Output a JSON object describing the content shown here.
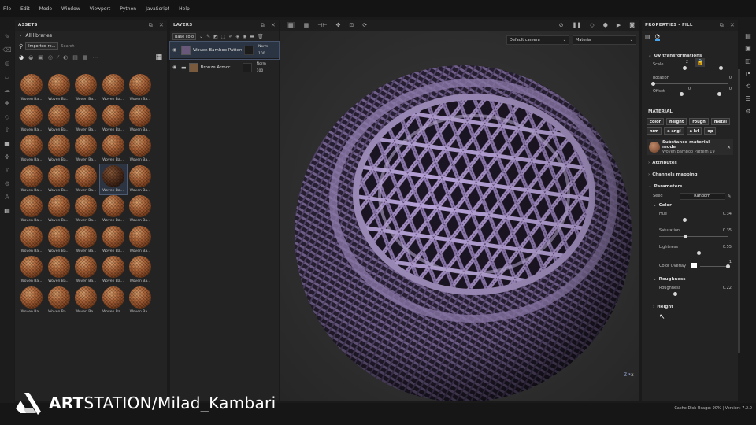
{
  "menu": [
    "File",
    "Edit",
    "Mode",
    "Window",
    "Viewport",
    "Python",
    "JavaScript",
    "Help"
  ],
  "assets": {
    "title": "ASSETS",
    "library": "All libraries",
    "filter_chip": "Imported re...",
    "search_placeholder": "Search",
    "item_label": "Woven Ba...",
    "item_count": 40,
    "selected_index": 18
  },
  "layers": {
    "title": "LAYERS",
    "channel": "Base colo",
    "items": [
      {
        "name": "Woven Bamboo Pattern 19",
        "blend": "Norm",
        "opacity": "100",
        "selected": true
      },
      {
        "name": "Bronze Armor",
        "blend": "Norm",
        "opacity": "100",
        "selected": false
      }
    ]
  },
  "viewport": {
    "camera": "Default camera",
    "mode": "Material"
  },
  "properties": {
    "title": "PROPERTIES - FILL",
    "uv_title": "UV transformations",
    "scale_label": "Scale",
    "scale_value": "2",
    "rotation_label": "Rotation",
    "rotation_value": "0",
    "offset_label": "Offset",
    "offset_x": "0",
    "offset_y": "0",
    "material_title": "MATERIAL",
    "material_buttons": [
      "color",
      "height",
      "rough",
      "metal",
      "nrm",
      "a angl",
      "a lvl",
      "op"
    ],
    "substance_mode": "Substance material mode",
    "substance_name": "Woven Bamboo Pattern 19",
    "attributes": "Attributes",
    "channels_mapping": "Channels mapping",
    "parameters": "Parameters",
    "seed_label": "Seed",
    "seed_value": "Random",
    "color_group": "Color",
    "hue_label": "Hue",
    "hue_value": "0.34",
    "sat_label": "Saturation",
    "sat_value": "0.35",
    "light_label": "Lightness",
    "light_value": "0.55",
    "overlay_label": "Color Overlay",
    "overlay_value": "1",
    "rough_group": "Roughness",
    "rough_label": "Roughness",
    "rough_value": "0.22",
    "height_group": "Height"
  },
  "status": "Cache Disk Usage:  90% | Version: 7.2.0",
  "watermark": {
    "art": "ART",
    "rest": "STATION/Milad_Kambari"
  },
  "colors": {
    "accent": "#4aa3e8",
    "weave_light": "#b7a3d8",
    "weave_dark": "#3a2c4e"
  },
  "icons": {
    "left_tools": [
      "paint-brush-icon",
      "eraser-icon",
      "projection-icon",
      "polygon-fill-icon",
      "smudge-icon",
      "clone-icon",
      "picker-icon",
      "layers-icon",
      "shelf-icon",
      "bake-icon",
      "export-icon",
      "share-icon",
      "text-icon",
      "document-icon"
    ],
    "right_tools": [
      "texture-set-list-icon",
      "texture-set-settings-icon",
      "shader-settings-icon",
      "display-settings-icon",
      "history-icon",
      "log-icon",
      "plugins-icon"
    ]
  }
}
